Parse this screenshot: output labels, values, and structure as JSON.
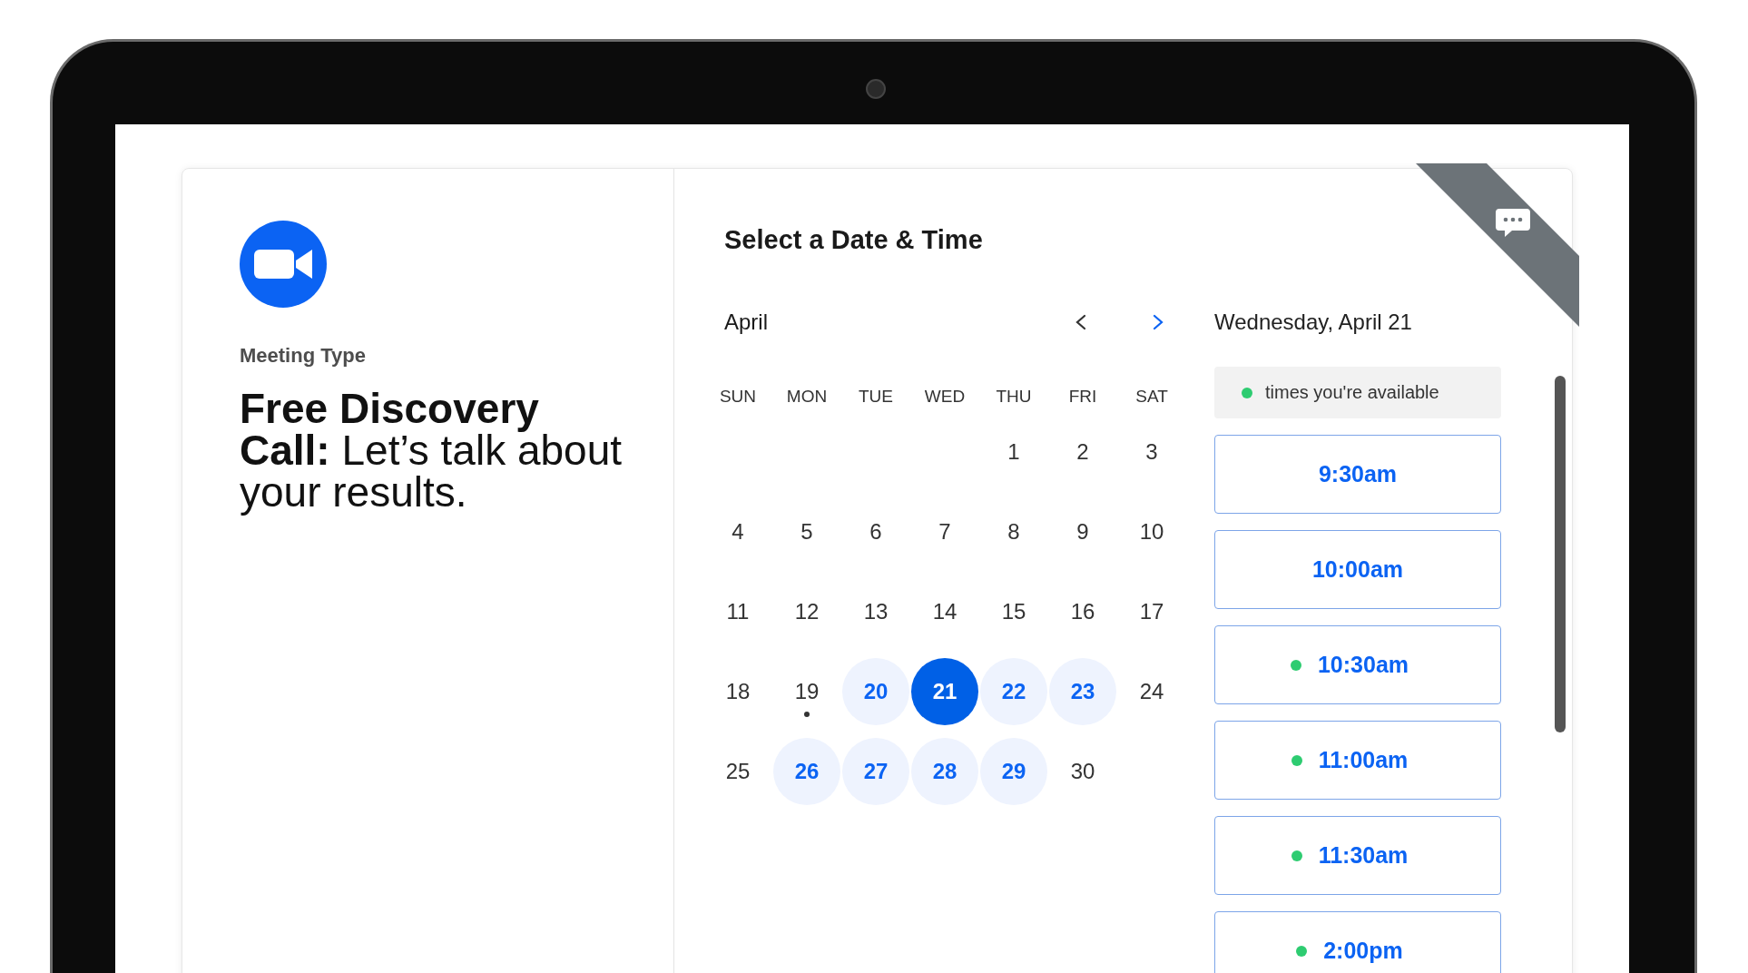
{
  "meeting": {
    "label": "Meeting Type",
    "title": "Free Discovery Call:",
    "subtitle": "Let’s talk about your results."
  },
  "scheduler": {
    "title": "Select a Date & Time"
  },
  "calendar": {
    "month": "April",
    "prev_disabled": true,
    "next_disabled": false,
    "weekdays": [
      "SUN",
      "MON",
      "TUE",
      "WED",
      "THU",
      "FRI",
      "SAT"
    ],
    "weeks": [
      [
        {
          "day": "1",
          "available": false,
          "selected": false,
          "today": false
        },
        {
          "day": "2",
          "available": false,
          "selected": false,
          "today": false
        },
        {
          "day": "3",
          "available": false,
          "selected": false,
          "today": false
        }
      ],
      [
        {
          "day": "4",
          "available": false,
          "selected": false,
          "today": false
        },
        {
          "day": "5",
          "available": false,
          "selected": false,
          "today": false
        },
        {
          "day": "6",
          "available": false,
          "selected": false,
          "today": false
        },
        {
          "day": "7",
          "available": false,
          "selected": false,
          "today": false
        },
        {
          "day": "8",
          "available": false,
          "selected": false,
          "today": false
        },
        {
          "day": "9",
          "available": false,
          "selected": false,
          "today": false
        },
        {
          "day": "10",
          "available": false,
          "selected": false,
          "today": false
        }
      ],
      [
        {
          "day": "11",
          "available": false,
          "selected": false,
          "today": false
        },
        {
          "day": "12",
          "available": false,
          "selected": false,
          "today": false
        },
        {
          "day": "13",
          "available": false,
          "selected": false,
          "today": false
        },
        {
          "day": "14",
          "available": false,
          "selected": false,
          "today": false
        },
        {
          "day": "15",
          "available": false,
          "selected": false,
          "today": false
        },
        {
          "day": "16",
          "available": false,
          "selected": false,
          "today": false
        },
        {
          "day": "17",
          "available": false,
          "selected": false,
          "today": false
        }
      ],
      [
        {
          "day": "18",
          "available": false,
          "selected": false,
          "today": false
        },
        {
          "day": "19",
          "available": false,
          "selected": false,
          "today": true
        },
        {
          "day": "20",
          "available": true,
          "selected": false,
          "today": false
        },
        {
          "day": "21",
          "available": true,
          "selected": true,
          "today": false
        },
        {
          "day": "22",
          "available": true,
          "selected": false,
          "today": false
        },
        {
          "day": "23",
          "available": true,
          "selected": false,
          "today": false
        },
        {
          "day": "24",
          "available": false,
          "selected": false,
          "today": false
        }
      ],
      [
        {
          "day": "25",
          "available": false,
          "selected": false,
          "today": false
        },
        {
          "day": "26",
          "available": true,
          "selected": false,
          "today": false
        },
        {
          "day": "27",
          "available": true,
          "selected": false,
          "today": false
        },
        {
          "day": "28",
          "available": true,
          "selected": false,
          "today": false
        },
        {
          "day": "29",
          "available": true,
          "selected": false,
          "today": false
        },
        {
          "day": "30",
          "available": false,
          "selected": false,
          "today": false
        }
      ]
    ]
  },
  "times": {
    "date": "Wednesday, April 21",
    "legend": "times you're available",
    "slots": [
      {
        "label": "9:30am",
        "available": false
      },
      {
        "label": "10:00am",
        "available": false
      },
      {
        "label": "10:30am",
        "available": true
      },
      {
        "label": "11:00am",
        "available": true
      },
      {
        "label": "11:30am",
        "available": true
      },
      {
        "label": "2:00pm",
        "available": true
      }
    ]
  }
}
